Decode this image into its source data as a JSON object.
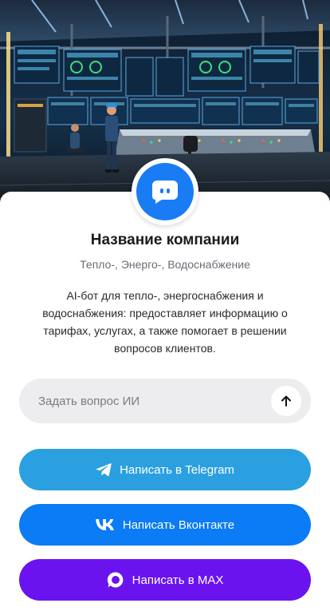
{
  "company": {
    "name": "Название компании",
    "tagline": "Тепло-, Энерго-, Водоснабжение",
    "description": "AI-бот для тепло-, энергоснабжения и водоснабжения: предоставляет информацию о тарифах, услугах, а также помогает в решении вопросов клиентов.",
    "avatar_icon": "chat-bot-icon",
    "avatar_color": "#1a7cf5"
  },
  "ask": {
    "placeholder": "Задать вопрос ИИ",
    "value": "",
    "send_icon": "arrow-up-icon"
  },
  "buttons": [
    {
      "label": "Написать в Telegram",
      "icon": "telegram-icon",
      "color": "#2ba0e0"
    },
    {
      "label": "Написать Вконтакте",
      "icon": "vk-icon",
      "color": "#0b7bf6"
    },
    {
      "label": "Написать в MAX",
      "icon": "max-icon",
      "color": "#6a13ee"
    }
  ],
  "hero": {
    "subject": "control-room-illustration"
  }
}
